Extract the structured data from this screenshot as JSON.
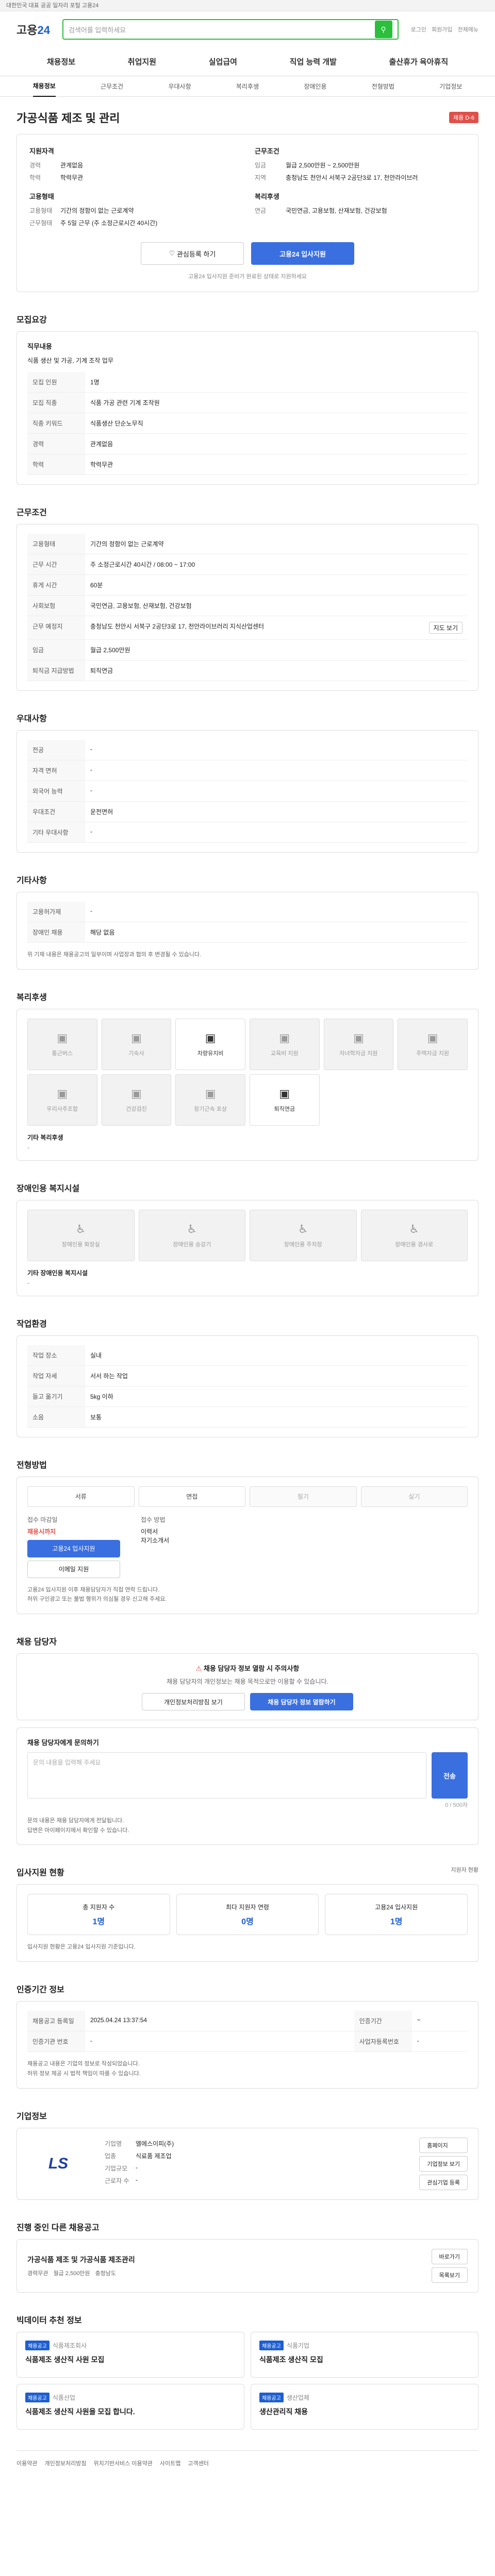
{
  "top": {
    "notice": "대한민국 대표 공공 일자리 포털 고용24"
  },
  "header": {
    "logo_a": "고용",
    "logo_b": "24",
    "search_placeholder": "검색어를 입력하세요",
    "util": [
      "로그인",
      "회원가입",
      "전체메뉴"
    ]
  },
  "gnb": [
    "채용정보",
    "취업지원",
    "실업급여",
    "직업 능력 개발",
    "출산휴가 육아휴직"
  ],
  "subnav": [
    "채용정보",
    "근무조건",
    "우대사항",
    "복리후생",
    "장애인용",
    "전형방법",
    "기업정보"
  ],
  "title": "가공식품 제조 및 관리",
  "badge": "채용 D-6",
  "summary": {
    "left_title": "지원자격",
    "left": [
      {
        "k": "경력",
        "v": "관계없음"
      },
      {
        "k": "학력",
        "v": "학력무관"
      }
    ],
    "left2_title": "고용형태",
    "left2": [
      {
        "k": "고용형태",
        "v": "기간의 정함이 없는 근로계약"
      },
      {
        "k": "근무형태",
        "v": "주 5일 근무 (주 소정근로시간 40시간)"
      }
    ],
    "right_title": "근무조건",
    "right": [
      {
        "k": "임금",
        "v": "월급 2,500만원 ~ 2,500만원"
      },
      {
        "k": "지역",
        "v": "충청남도 천안시 서북구 2공단3로 17, 천안라이브러"
      }
    ],
    "right2_title": "복리후생",
    "right2": [
      {
        "k": "연금",
        "v": "국민연금, 고용보험, 산재보험, 건강보험"
      }
    ],
    "btn_save": "관심등록 하기",
    "btn_apply": "고용24 입사지원",
    "note": "고용24 입사지원 준비가 완료된 상태로 지원하세요"
  },
  "sections": {
    "recruit": "모집요강",
    "work": "근무조건",
    "pref": "우대사항",
    "etc": "기타사항",
    "welfare": "복리후생",
    "disabled": "장애인용 복지시설",
    "workenv": "작업환경",
    "method": "전형방법",
    "contact": "채용 담당자",
    "status": "입사지원 현황",
    "info": "인증기간 정보",
    "company": "기업정보",
    "similar": "진행 중인 다른 채용공고",
    "rec": "빅데이터 추천 정보"
  },
  "recruit": {
    "duty_title": "직무내용",
    "duty": "식품 생산 및 가공, 기계 조작 업무",
    "rows": [
      {
        "k": "모집 인원",
        "v": "1명"
      },
      {
        "k": "모집 직종",
        "v": "식품 가공 관련 기계 조작원"
      },
      {
        "k": "직종 키워드",
        "v": "식품생산 단순노무직"
      },
      {
        "k": "경력",
        "v": "관계없음"
      },
      {
        "k": "학력",
        "v": "학력무관"
      }
    ]
  },
  "work": {
    "rows": [
      {
        "k": "고용형태",
        "v": "기간의 정함이 없는 근로계약"
      },
      {
        "k": "근무 시간",
        "v": "주 소정근로시간 40시간 / 08:00 ~ 17:00"
      },
      {
        "k": "휴게 시간",
        "v": "60분"
      },
      {
        "k": "사회보험",
        "v": "국민연금, 고용보험, 산재보험, 건강보험"
      },
      {
        "k": "근무 예정지",
        "v": "충청남도 천안시 서북구 2공단3로 17, 천안라이브러리 지식산업센터"
      },
      {
        "k": "임금",
        "v": "월급 2,500만원"
      },
      {
        "k": "퇴직금 지급방법",
        "v": "퇴직연금"
      }
    ],
    "map_btn": "지도 보기"
  },
  "pref": {
    "rows": [
      {
        "k": "전공",
        "v": "-"
      },
      {
        "k": "자격 면허",
        "v": "-"
      },
      {
        "k": "외국어 능력",
        "v": "-"
      },
      {
        "k": "우대조건",
        "v": "운전면허"
      },
      {
        "k": "기타 우대사항",
        "v": "-"
      }
    ]
  },
  "etc": {
    "rows": [
      {
        "k": "고용허가제",
        "v": "-"
      },
      {
        "k": "장애인 채용",
        "v": "해당 없음"
      }
    ]
  },
  "etc_note": "위 기재 내용은 채용공고의 일부이며 사업장과 협의 후 변경될 수 있습니다.",
  "welfare": {
    "items": [
      "통근버스",
      "기숙사",
      "차량유지비",
      "교육비 지원",
      "자녀학자금 지원",
      "주택자금 지원",
      "우리사주조합",
      "건강검진",
      "장기근속 포상",
      "퇴직연금"
    ],
    "on": [
      2,
      9
    ],
    "etc_label": "기타 복리후생",
    "etc_val": "-"
  },
  "disabled": {
    "items": [
      "장애인용 화장실",
      "장애인용 승강기",
      "장애인용 주차장",
      "장애인용 경사로"
    ],
    "etc_label": "기타 장애인용 복지시설",
    "etc_val": "-"
  },
  "workenv": {
    "rows": [
      {
        "k": "작업 장소",
        "v": "실내"
      },
      {
        "k": "작업 자세",
        "v": "서서 하는 작업"
      },
      {
        "k": "들고 옮기기",
        "v": "5kg 이하"
      },
      {
        "k": "소음",
        "v": "보통"
      }
    ]
  },
  "method": {
    "items": [
      "서류",
      "면접",
      "필기",
      "실기"
    ],
    "on": [
      0,
      1
    ],
    "apply_label": "접수 마감일",
    "apply_date": "채용시까지",
    "apply_btn": "고용24 입사지원",
    "apply_btn2": "이메일 지원",
    "doc_label": "접수 방법",
    "doc_list": [
      "이력서",
      "자기소개서"
    ],
    "notes": [
      "고용24 입사지원 이후 채용담당자가 직접 연락 드립니다.",
      "허위 구인광고 또는 불법 행위가 의심될 경우 신고해 주세요."
    ]
  },
  "contact": {
    "warn_title": "채용 담당자 정보 열람 시 주의사항",
    "warn_text": "채용 담당자의 개인정보는 채용 목적으로만 이용할 수 있습니다.",
    "btn1": "개인정보처리방침 보기",
    "btn2": "채용 담당자 정보 열람하기",
    "inquiry_label": "채용 담당자에게 문의하기",
    "inquiry_placeholder": "문의 내용을 입력해 주세요",
    "submit": "전송",
    "count": "0 / 500자",
    "bullets": [
      "문의 내용은 채용 담당자에게 전달됩니다.",
      "답변은 마이페이지에서 확인할 수 있습니다."
    ]
  },
  "status": {
    "more": "지원자 현황",
    "items": [
      {
        "k": "총 지원자 수",
        "v": "1명"
      },
      {
        "k": "최다 지원자 연령",
        "v": "0명"
      },
      {
        "k": "고용24 입사지원",
        "v": "1명"
      }
    ],
    "note": "입사지원 현황은 고용24 입사지원 기준입니다."
  },
  "info": {
    "rows": [
      {
        "k": "채용공고 등록일",
        "v": "2025.04.24 13:37:54",
        "k2": "인증기간",
        "v2": "~"
      },
      {
        "k": "인증기관 번호",
        "v": "-",
        "k2": "사업자등록번호",
        "v2": "-"
      }
    ],
    "bullets": [
      "채용공고 내용은 기업의 정보로 작성되었습니다.",
      "허위 정보 제공 시 법적 책임이 따를 수 있습니다."
    ]
  },
  "company": {
    "logo_text": "LS",
    "rows": [
      {
        "k": "기업명",
        "v": "엘에스이피(주)"
      },
      {
        "k": "업종",
        "v": "식료품 제조업"
      },
      {
        "k": "기업규모",
        "v": "-"
      },
      {
        "k": "근로자 수",
        "v": "-"
      }
    ],
    "btns": [
      "홈페이지",
      "기업정보 보기",
      "관심기업 등록"
    ]
  },
  "similar": {
    "title": "가공식품 제조 및 가공식품 제조관리",
    "btn1": "바로가기",
    "btn2": "목록보기",
    "meta": [
      "경력무관",
      "월급 2,500만원",
      "충청남도"
    ]
  },
  "rec": [
    {
      "tag": "채용공고",
      "title": "식품제조 생산직 사원 모집",
      "co": "식품제조회사"
    },
    {
      "tag": "채용공고",
      "title": "식품제조 생산직 모집",
      "co": "식품기업"
    },
    {
      "tag": "채용공고",
      "title": "식품제조 생산직 사원을 모집 합니다.",
      "co": "식품산업"
    },
    {
      "tag": "채용공고",
      "title": "생산관리직 채용",
      "co": "생산업체"
    }
  ],
  "footer": [
    "이용약관",
    "개인정보처리방침",
    "위치기반서비스 이용약관",
    "사이트맵",
    "고객센터"
  ],
  "colors": {
    "brand": "#1d5fd1",
    "accent": "#2bbf3b",
    "danger": "#e0504a"
  }
}
